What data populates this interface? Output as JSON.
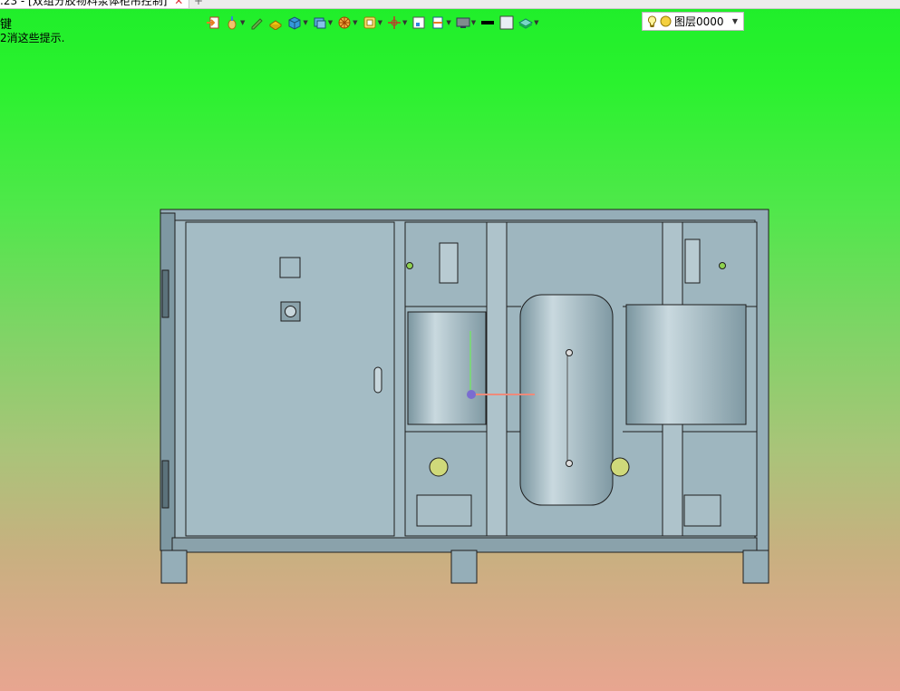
{
  "app": {
    "tab_title": ".23 - [双组分胶物料泵体柜吊控制]",
    "tab_close": "✕",
    "tab_add": "+"
  },
  "hints": {
    "line1": "键",
    "line2": "2消这些提示."
  },
  "toolbar": {
    "buttons": [
      {
        "name": "import",
        "icon": "import-icon"
      },
      {
        "name": "mouse",
        "icon": "mouse-icon"
      },
      {
        "name": "measure",
        "icon": "pencil-icon"
      },
      {
        "name": "face",
        "icon": "face-icon"
      },
      {
        "name": "solid",
        "icon": "cube-icon"
      },
      {
        "name": "views",
        "icon": "views-icon"
      },
      {
        "name": "render",
        "icon": "render-icon"
      },
      {
        "name": "filter",
        "icon": "filter-icon"
      },
      {
        "name": "origin",
        "icon": "axis-icon"
      },
      {
        "name": "fit",
        "icon": "fit-icon"
      },
      {
        "name": "section",
        "icon": "section-icon"
      },
      {
        "name": "display",
        "icon": "display-icon"
      },
      {
        "name": "line-color",
        "icon": "line-icon"
      },
      {
        "name": "fill-color",
        "icon": "square-icon"
      },
      {
        "name": "layers",
        "icon": "layers-icon"
      }
    ],
    "colors": {
      "accent_orange": "#f08a1c",
      "accent_blue": "#2f7fd6"
    }
  },
  "layer_select": {
    "value": "图层0000",
    "icons": [
      "bulb-icon",
      "sun-icon"
    ]
  },
  "viewport": {
    "background_top": "#1fee2a",
    "background_bottom": "#e8a590",
    "model_color": "#9ab3bd",
    "edge_color": "#222222"
  }
}
